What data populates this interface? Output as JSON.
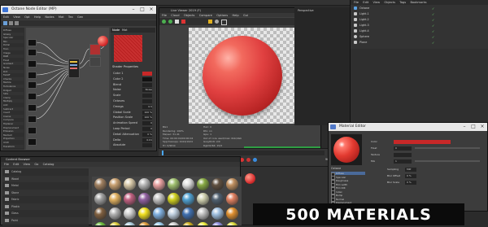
{
  "node_editor": {
    "title": "Octane Node Editor (MP)",
    "menus": [
      "Edit",
      "View",
      "Opt",
      "Help",
      "Nodes",
      "Mat",
      "Tex",
      "Gen"
    ],
    "node_list": [
      "Diffuse",
      "Glossy",
      "Specular",
      "Mix",
      "Portal",
      "Toon",
      "Image",
      "RGB",
      "Float",
      "Gradient",
      "Noise",
      "Dirt",
      "Falloff",
      "Checks",
      "Marble",
      "Turbulence",
      "Ridged",
      "Side",
      "Clamp",
      "Multiply",
      "Add",
      "Subtract",
      "Invert",
      "Cosine",
      "Compare",
      "Triplanar",
      "Displacement",
      "Emission",
      "Medium",
      "Projection",
      "UVW",
      "Transform"
    ],
    "tabs": [
      "Node",
      "Mat"
    ],
    "properties_title": "Shader Properties",
    "properties": [
      {
        "label": "Color 1",
        "value": ""
      },
      {
        "label": "Color 2",
        "value": ""
      },
      {
        "label": "Blend",
        "value": ""
      },
      {
        "label": "Noise",
        "value": "Noise"
      },
      {
        "label": "Scale",
        "value": ""
      },
      {
        "label": "Octaves",
        "value": ""
      },
      {
        "label": "Omega",
        "value": "0.5"
      },
      {
        "label": "Global Scale",
        "value": "100 %"
      },
      {
        "label": "Position Scale",
        "value": "100 %"
      },
      {
        "label": "Animation Speed",
        "value": "0"
      },
      {
        "label": "Loop Period",
        "value": "0"
      },
      {
        "label": "Detail Attenuation",
        "value": "0 %"
      },
      {
        "label": "Delta",
        "value": "0.01"
      },
      {
        "label": "Absolute",
        "value": ""
      }
    ]
  },
  "viewer": {
    "title": "Live Viewer 2019 (F)",
    "menus": [
      "File",
      "Cloud",
      "Objects",
      "Compare",
      "Options",
      "Help",
      "Gui"
    ],
    "render_status": [
      "Rendering",
      "Samples",
      "Memory",
      "Time",
      "Mesh",
      "Gpu"
    ],
    "readouts": [
      "BG1 ",
      "Rendering: 100%",
      "Ms/sec: 31.41",
      "Time: 00:00:04/00:00:04",
      "Spp/maxspp: 1024/1024",
      "Tri: 0/961k",
      "Mesh: 3",
      "Hair: 0",
      "Rtx: on",
      "Gpu: 1",
      "Out of core used/max: 0kb/4Gb",
      "Grey8/16: 2/0",
      "Rgb32/64: 15/0",
      "Used/free/total vram: 1.512Gb/8.1Gb/11Gb"
    ]
  },
  "c4d_viewport": {
    "title": "Perspective"
  },
  "objects": {
    "menus": [
      "File",
      "Edit",
      "View",
      "Objects",
      "Tags",
      "Bookmarks"
    ],
    "items": [
      "Octane",
      "Light.1",
      "Light.2",
      "Light.3",
      "Light.4",
      "Sphere",
      "Plane"
    ]
  },
  "timeline": {
    "frame_start": "0 F",
    "frame_end": "90 F",
    "current": "0 F"
  },
  "content_browser": {
    "title": "Content Browser",
    "menus": [
      "File",
      "Edit",
      "View",
      "Go",
      "Catalog"
    ],
    "folders": [
      "Catalog",
      "Wood",
      "Metal",
      "Stone",
      "Fabric",
      "Plastic",
      "Glass",
      "Paint"
    ],
    "swatch_colors": [
      "#a08060",
      "#c8a070",
      "#d8c8a8",
      "#b8b8b8",
      "#e8a0a0",
      "#a0c070",
      "#e0e0e0",
      "#88aa44",
      "#605040",
      "#c09060",
      "#a0a0a0",
      "#e0b060",
      "#c06080",
      "#9060a0",
      "#c0c0c0",
      "#d0d020",
      "#50a0d0",
      "#d0d0b0",
      "#506070",
      "#e08060",
      "#806040",
      "#b0b0b0",
      "#d0d0d0",
      "#f0e020",
      "#80b0e0",
      "#c0d0e0",
      "#4070b0",
      "#c0c0c0",
      "#a0c0e0",
      "#e09030",
      "#70c040",
      "#e0d040",
      "#b0d0e0",
      "#e0a040",
      "#a0d0f0",
      "#d0d0d0",
      "#d0b020",
      "#f0f040",
      "#9090e0",
      "#e0e040"
    ]
  },
  "material_editor": {
    "title": "Material Editor",
    "preview_label": "Octane",
    "channels": [
      "Diffuse",
      "Specular",
      "Roughness",
      "Film width",
      "Film IOR",
      "Index",
      "Bump",
      "Normal",
      "Displacement",
      "Opacity",
      "Transmission",
      "Medium",
      "Common",
      "Editor",
      "Assign"
    ],
    "fields": [
      {
        "label": "Color",
        "value": ""
      },
      {
        "label": "Float",
        "value": "0"
      },
      {
        "label": "Texture",
        "value": ""
      },
      {
        "label": "Mix",
        "value": "1"
      },
      {
        "label": "Sampling",
        "value": "MIP"
      },
      {
        "label": "Blur Offset",
        "value": "0 %"
      },
      {
        "label": "Blur Scale",
        "value": "0 %"
      }
    ],
    "channel_selected": "Diffuse"
  },
  "headline": "500 MATERIALS"
}
